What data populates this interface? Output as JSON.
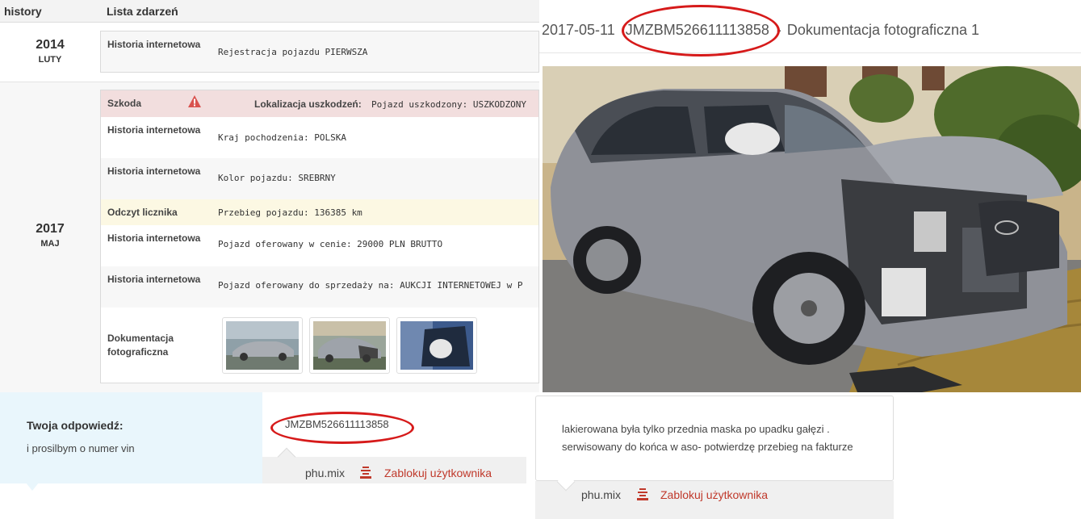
{
  "history": {
    "header_left": "history",
    "header_right": "Lista zdarzeń",
    "sections": [
      {
        "year": "2014",
        "month": "LUTY",
        "events": [
          {
            "type": "Historia internetowa",
            "text": "Rejestracja pojazdu PIERWSZA"
          }
        ]
      },
      {
        "year": "2017",
        "month": "MAJ",
        "events": [
          {
            "type": "Szkoda",
            "label": "Lokalizacja uszkodzeń:",
            "text": "Pojazd uszkodzony: USZKODZONY"
          },
          {
            "type": "Historia internetowa",
            "text": "Kraj pochodzenia: POLSKA"
          },
          {
            "type": "Historia internetowa",
            "text": "Kolor pojazdu: SREBRNY"
          },
          {
            "type": "Odczyt licznika",
            "text": "Przebieg pojazdu: 136385 km"
          },
          {
            "type": "Historia internetowa",
            "text": "Pojazd oferowany w cenie: 29000 PLN BRUTTO"
          },
          {
            "type": "Historia internetowa",
            "text": "Pojazd oferowany do sprzedaży na: AUKCJI INTERNETOWEJ w P"
          },
          {
            "type": "Dokumentacja fotograficzna",
            "text": ""
          }
        ]
      }
    ]
  },
  "photo": {
    "date": "2017-05-11",
    "vin": "JMZBM526611113858",
    "separator": "-",
    "title": "Dokumentacja fotograficzna 1"
  },
  "answer": {
    "label": "Twoja odpowiedź:",
    "value": "i prosilbym o numer vin"
  },
  "reply1": {
    "message": "JMZBM526611113858",
    "user": "phu.mix",
    "block_label": "Zablokuj użytkownika"
  },
  "reply2": {
    "line1": "lakierowana była tylko przednia maska po upadku gałęzi .",
    "line2": "serwisowany do końca w aso- potwierdzę przebieg na fakturze",
    "user": "phu.mix",
    "block_label": "Zablokuj użytkownika"
  },
  "colors": {
    "annotation_red": "#d61a1a",
    "damage_row": "#f2dede",
    "odometer_row": "#fcf8e3",
    "answer_bg": "#e9f6fc",
    "block_link": "#c0392b"
  },
  "icons": [
    "warning-triangle-icon",
    "block-user-icon"
  ]
}
